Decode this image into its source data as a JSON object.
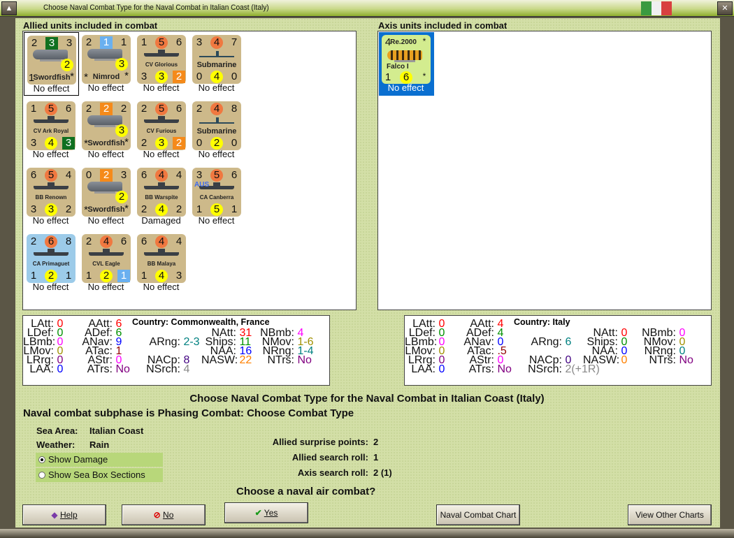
{
  "window": {
    "title": "Choose Naval Combat Type for the Naval Combat in Italian Coast (Italy)",
    "flag_colors": [
      "#3a9a40",
      "#f0f0f0",
      "#d84040"
    ]
  },
  "allied": {
    "heading": "Allied units included in combat",
    "units": [
      {
        "type": "plane",
        "tl": "2",
        "tm": "3",
        "tms": "sq-gr",
        "tr": "3",
        "mid": "2",
        "bl": "1",
        "name": "Swordfish",
        "br": "*",
        "status": "No effect",
        "selected": true
      },
      {
        "type": "plane",
        "tl": "2",
        "tm": "1",
        "tms": "sq-bl",
        "tr": "1",
        "mid": "3",
        "bl": "*",
        "name": "Nimrod",
        "br": "*",
        "status": "No effect"
      },
      {
        "type": "ship",
        "tl": "1",
        "tm": "5",
        "tr": "6",
        "name": "CV Glorious",
        "bl": "3",
        "bm": "3",
        "br": "2",
        "brs": "sq-or",
        "status": "No effect"
      },
      {
        "type": "sub",
        "tl": "3",
        "tm": "4",
        "tr": "7",
        "name": "Submarine",
        "bl": "0",
        "bm": "4",
        "br": "0",
        "status": "No effect"
      },
      {
        "type": "ship",
        "tl": "1",
        "tm": "5",
        "tr": "6",
        "name": "CV Ark Royal",
        "bl": "3",
        "bm": "4",
        "br": "3",
        "brs": "sq-gr",
        "status": "No effect"
      },
      {
        "type": "plane",
        "tl": "2",
        "tm": "2",
        "tms": "sq-or",
        "tr": "2",
        "mid": "3",
        "bl": "*",
        "name": "Swordfish",
        "br": "*",
        "status": "No effect"
      },
      {
        "type": "ship",
        "tl": "2",
        "tm": "5",
        "tr": "6",
        "name": "CV Furious",
        "bl": "2",
        "bm": "3",
        "br": "2",
        "brs": "sq-or",
        "status": "No effect"
      },
      {
        "type": "sub",
        "tl": "2",
        "tm": "4",
        "tr": "8",
        "name": "Submarine",
        "bl": "0",
        "bm": "2",
        "br": "0",
        "status": "No effect"
      },
      {
        "type": "ship",
        "tl": "6",
        "tm": "5",
        "tr": "4",
        "name": "BB Renown",
        "bl": "3",
        "bm": "3",
        "br": "2",
        "status": "No effect"
      },
      {
        "type": "plane",
        "tl": "0",
        "tm": "2",
        "tms": "sq-or",
        "tr": "3",
        "mid": "2",
        "bl": "*",
        "name": "Swordfish",
        "br": "*",
        "status": "No effect"
      },
      {
        "type": "ship",
        "tl": "6",
        "tm": "4",
        "tr": "4",
        "name": "BB Warspite",
        "bl": "2",
        "bm": "4",
        "br": "2",
        "status": "Damaged"
      },
      {
        "type": "ship",
        "tl": "3",
        "tm": "5",
        "tr": "6",
        "name": "CA Canberra",
        "tag": "AUS",
        "bl": "1",
        "bm": "5",
        "br": "1",
        "status": "No effect"
      },
      {
        "type": "ship",
        "bg": "blue",
        "tl": "2",
        "tm": "6",
        "tr": "8",
        "name": "CA Primaguet",
        "bl": "1",
        "bm": "2",
        "br": "1",
        "status": "No effect"
      },
      {
        "type": "ship",
        "tl": "2",
        "tm": "4",
        "tr": "6",
        "name": "CVL Eagle",
        "bl": "1",
        "bm": "2",
        "br": "1",
        "brs": "sq-bl",
        "status": "No effect"
      },
      {
        "type": "ship",
        "tl": "6",
        "tm": "4",
        "tr": "4",
        "name": "BB Malaya",
        "bl": "1",
        "bm": "4",
        "br": "3",
        "status": "No effect"
      }
    ]
  },
  "axis": {
    "heading": "Axis units included in combat",
    "units": [
      {
        "type": "itplane",
        "tl": "4",
        "model": "Re.2000",
        "tr": "*",
        "name": "Falco I",
        "bl": "1",
        "bm": "6",
        "br": "*",
        "status": "No effect",
        "selected": true
      }
    ]
  },
  "allied_stats": {
    "country": "Country: Commonwealth, France",
    "columns": [
      [
        {
          "l": "LAtt:",
          "v": "0",
          "c": "#ff0000"
        },
        {
          "l": "LDef:",
          "v": "0",
          "c": "#009000"
        },
        {
          "l": "LBmb:",
          "v": "0",
          "c": "#ff00ff"
        },
        {
          "l": "LMov:",
          "v": "0",
          "c": "#a09000"
        },
        {
          "l": "LRrg:",
          "v": "0",
          "c": "#800080"
        },
        {
          "l": "LAA:",
          "v": "0",
          "c": "#0000ff"
        }
      ],
      [
        {
          "l": "AAtt:",
          "v": "6",
          "c": "#ff0000"
        },
        {
          "l": "ADef:",
          "v": "6",
          "c": "#009000"
        },
        {
          "l": "ANav:",
          "v": "9",
          "c": "#0000ff"
        },
        {
          "l": "ATac:",
          "v": "1",
          "c": "#900000"
        },
        {
          "l": "AStr:",
          "v": "0",
          "c": "#ff00ff"
        },
        {
          "l": "ATrs:",
          "v": "No",
          "c": "#800080"
        }
      ],
      [
        null,
        null,
        {
          "l": "ARng:",
          "v": "2-3",
          "c": "#008080"
        },
        null,
        {
          "l": "NACp:",
          "v": "8",
          "c": "#400080"
        },
        {
          "l": "NSrch:",
          "v": "4",
          "c": "#888888"
        }
      ],
      [
        null,
        {
          "l": "NAtt:",
          "v": "31",
          "c": "#ff0000"
        },
        {
          "l": "Ships:",
          "v": "11",
          "c": "#009000"
        },
        {
          "l": "NAA:",
          "v": "16",
          "c": "#0000ff"
        },
        {
          "l": "NASW:",
          "v": "22",
          "c": "#ff8000"
        },
        null
      ],
      [
        null,
        {
          "l": "NBmb:",
          "v": "4",
          "c": "#ff00ff"
        },
        {
          "l": "NMov:",
          "v": "1-6",
          "c": "#a09000"
        },
        {
          "l": "NRng:",
          "v": "1-4",
          "c": "#008080"
        },
        {
          "l": "NTrs:",
          "v": "No",
          "c": "#800080"
        },
        null
      ]
    ]
  },
  "axis_stats": {
    "country": "Country: Italy",
    "columns": [
      [
        {
          "l": "LAtt:",
          "v": "0",
          "c": "#ff0000"
        },
        {
          "l": "LDef:",
          "v": "0",
          "c": "#009000"
        },
        {
          "l": "LBmb:",
          "v": "0",
          "c": "#ff00ff"
        },
        {
          "l": "LMov:",
          "v": "0",
          "c": "#a09000"
        },
        {
          "l": "LRrg:",
          "v": "0",
          "c": "#800080"
        },
        {
          "l": "LAA:",
          "v": "0",
          "c": "#0000ff"
        }
      ],
      [
        {
          "l": "AAtt:",
          "v": "4",
          "c": "#ff0000"
        },
        {
          "l": "ADef:",
          "v": "4",
          "c": "#009000"
        },
        {
          "l": "ANav:",
          "v": "0",
          "c": "#0000ff"
        },
        {
          "l": "ATac:",
          "v": ".5",
          "c": "#900000"
        },
        {
          "l": "AStr:",
          "v": "0",
          "c": "#ff00ff"
        },
        {
          "l": "ATrs:",
          "v": "No",
          "c": "#800080"
        }
      ],
      [
        null,
        null,
        {
          "l": "ARng:",
          "v": "6",
          "c": "#008080"
        },
        null,
        {
          "l": "NACp:",
          "v": "0",
          "c": "#400080"
        },
        {
          "l": "NSrch:",
          "v": "2(+1R)",
          "c": "#888888"
        }
      ],
      [
        null,
        {
          "l": "NAtt:",
          "v": "0",
          "c": "#ff0000"
        },
        {
          "l": "Ships:",
          "v": "0",
          "c": "#009000"
        },
        {
          "l": "NAA:",
          "v": "0",
          "c": "#0000ff"
        },
        {
          "l": "NASW:",
          "v": "0",
          "c": "#ff8000"
        },
        null
      ],
      [
        null,
        {
          "l": "NBmb:",
          "v": "0",
          "c": "#ff00ff"
        },
        {
          "l": "NMov:",
          "v": "0",
          "c": "#a09000"
        },
        {
          "l": "NRng:",
          "v": "0",
          "c": "#008080"
        },
        {
          "l": "NTrs:",
          "v": "No",
          "c": "#800080"
        },
        null
      ]
    ]
  },
  "info": {
    "heading": "Choose Naval Combat Type for the Naval Combat in Italian Coast (Italy)",
    "subphase": "Naval combat subphase is Phasing Combat: Choose Combat Type",
    "sea_area_label": "Sea Area:",
    "sea_area": "Italian Coast",
    "weather_label": "Weather:",
    "weather": "Rain",
    "show_damage": "Show Damage",
    "show_sea_box": "Show Sea Box Sections",
    "surprise_label": "Allied surprise points:",
    "surprise": "2",
    "allied_search_label": "Allied search roll:",
    "allied_search": "1",
    "axis_search_label": "Axis search roll:",
    "axis_search": "2 (1)",
    "question": "Choose a naval air combat?"
  },
  "buttons": {
    "help": "Help",
    "no": "No",
    "yes": "Yes",
    "naval_chart": "Naval Combat Chart",
    "other_charts": "View Other Charts"
  }
}
